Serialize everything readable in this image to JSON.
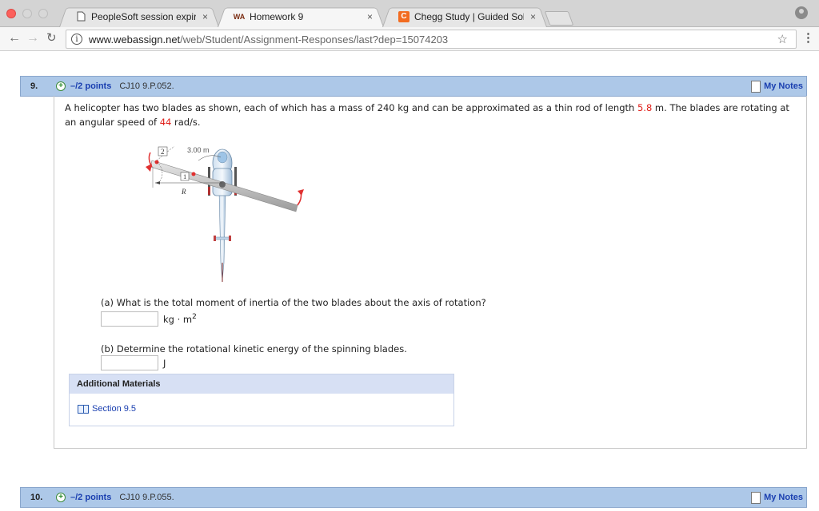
{
  "browser": {
    "tabs": [
      {
        "label": "PeopleSoft session expired",
        "close": "×",
        "icon": "document-icon"
      },
      {
        "label": "Homework 9",
        "close": "×",
        "icon": "webassign-icon",
        "icon_text": "WA"
      },
      {
        "label": "Chegg Study | Guided Solutio",
        "close": "×",
        "icon": "chegg-icon",
        "icon_text": "C"
      }
    ],
    "url_host": "www.webassign.net",
    "url_path": "/web/Student/Assignment-Responses/last?dep=15074203",
    "info_glyph": "i"
  },
  "question9": {
    "number": "9.",
    "points": "–/2 points",
    "code": "CJ10 9.P.052.",
    "my_notes": "My Notes",
    "text_before_length": "A helicopter has two blades as shown, each of which has a mass of 240 kg and can be approximated as a thin rod of length ",
    "length": "5.8",
    "text_after_length": " m. The blades are rotating at an angular speed of ",
    "speed": "44",
    "text_after_speed": " rad/s.",
    "figure": {
      "label_2": "2",
      "label_1": "1",
      "dim_label": "3.00 m",
      "r_label": "R"
    },
    "part_a": "(a) What is the total moment of inertia of the two blades about the axis of rotation?",
    "unit_a": "kg · m",
    "unit_a_sup": "2",
    "part_b": "(b) Determine the rotational kinetic energy of the spinning blades.",
    "unit_b": "J",
    "additional_materials": "Additional Materials",
    "section_link": "Section 9.5"
  },
  "question10": {
    "number": "10.",
    "points": "–/2 points",
    "code": "CJ10 9.P.055.",
    "my_notes": "My Notes"
  },
  "colors": {
    "qbar": "#adc8e8",
    "link": "#1a3fb0",
    "highlight": "#e0201b"
  }
}
